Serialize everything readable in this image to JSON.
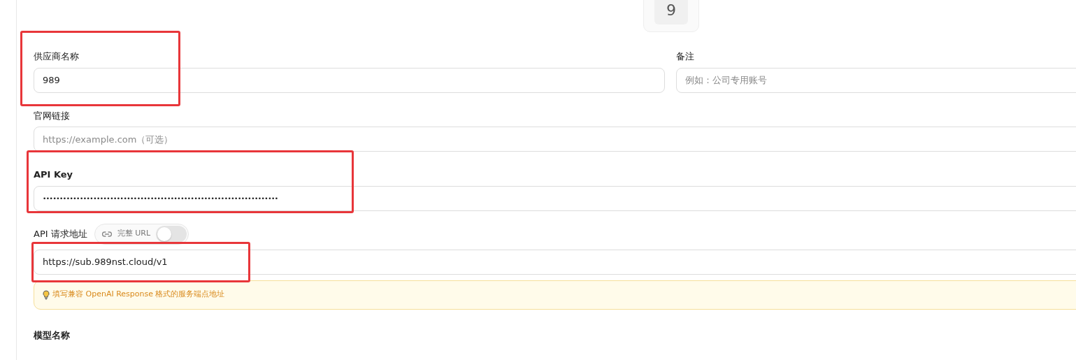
{
  "badge": {
    "text": "9"
  },
  "row_fields": [
    {
      "label": "供应商名称",
      "value": "989",
      "highlighted": true
    },
    {
      "label": "备注",
      "placeholder": "例如：公司专用账号"
    }
  ],
  "website": {
    "label": "官网链接",
    "placeholder": "https://example.com（可选）"
  },
  "api_key": {
    "label": "API Key",
    "value": "••••••••••••••••••••••••••••••••••••••••••••••••••••••••••••••••••••••",
    "highlighted": true
  },
  "endpoint": {
    "label": "API 请求地址",
    "toggle": {
      "label": "完整 URL",
      "on": false
    },
    "value": "https://sub.989nst.cloud/v1",
    "highlighted": true,
    "hint": "填写兼容 OpenAI Response 格式的服务端点地址"
  },
  "model": {
    "label": "模型名称"
  }
}
